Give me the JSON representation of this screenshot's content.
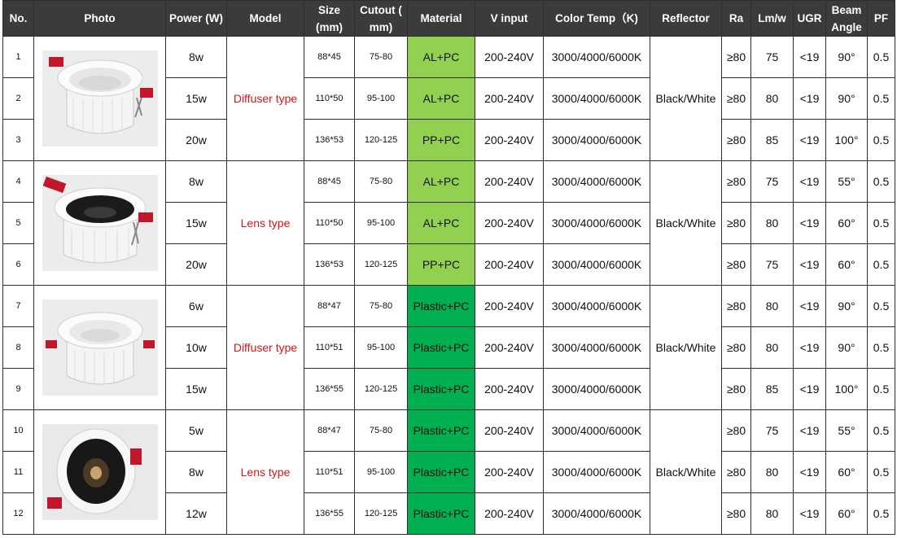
{
  "columns": {
    "no": "No.",
    "photo": "Photo",
    "power": "Power (W)",
    "model": "Model",
    "size": "Size (mm)",
    "cutout": "Cutout ( mm)",
    "material": "Material",
    "vinput": "V input",
    "colortemp": "Color Temp（K)",
    "reflector": "Reflector",
    "ra": "Ra",
    "lmw": "Lm/w",
    "ugr": "UGR",
    "beam": "Beam Angle",
    "pf": "PF"
  },
  "groups": [
    {
      "model": "Diffuser type",
      "reflector": "Black/White",
      "photo_icon": "white-diffuser-downlight-photo"
    },
    {
      "model": "Lens type",
      "reflector": "Black/White",
      "photo_icon": "black-lens-downlight-photo"
    },
    {
      "model": "Diffuser type",
      "reflector": "Black/White",
      "photo_icon": "white-plastic-diffuser-downlight-photo"
    },
    {
      "model": "Lens type",
      "reflector": "Black/White",
      "photo_icon": "black-plastic-lens-downlight-photo"
    }
  ],
  "rows": [
    {
      "no": "1",
      "power": "8w",
      "size": "88*45",
      "cutout": "75-80",
      "material": "AL+PC",
      "vinput": "200-240V",
      "colortemp": "3000/4000/6000K",
      "ra": "≥80",
      "lmw": "75",
      "ugr": "<19",
      "beam": "90°",
      "pf": "0.5"
    },
    {
      "no": "2",
      "power": "15w",
      "size": "110*50",
      "cutout": "95-100",
      "material": "AL+PC",
      "vinput": "200-240V",
      "colortemp": "3000/4000/6000K",
      "ra": "≥80",
      "lmw": "80",
      "ugr": "<19",
      "beam": "90°",
      "pf": "0.5"
    },
    {
      "no": "3",
      "power": "20w",
      "size": "136*53",
      "cutout": "120-125",
      "material": "PP+PC",
      "vinput": "200-240V",
      "colortemp": "3000/4000/6000K",
      "ra": "≥80",
      "lmw": "85",
      "ugr": "<19",
      "beam": "100°",
      "pf": "0.5"
    },
    {
      "no": "4",
      "power": "8w",
      "size": "88*45",
      "cutout": "75-80",
      "material": "AL+PC",
      "vinput": "200-240V",
      "colortemp": "3000/4000/6000K",
      "ra": "≥80",
      "lmw": "75",
      "ugr": "<19",
      "beam": "55°",
      "pf": "0.5"
    },
    {
      "no": "5",
      "power": "15w",
      "size": "110*50",
      "cutout": "95-100",
      "material": "AL+PC",
      "vinput": "200-240V",
      "colortemp": "3000/4000/6000K",
      "ra": "≥80",
      "lmw": "80",
      "ugr": "<19",
      "beam": "60°",
      "pf": "0.5"
    },
    {
      "no": "6",
      "power": "20w",
      "size": "136*53",
      "cutout": "120-125",
      "material": "PP+PC",
      "vinput": "200-240V",
      "colortemp": "3000/4000/6000K",
      "ra": "≥80",
      "lmw": "75",
      "ugr": "<19",
      "beam": "60°",
      "pf": "0.5"
    },
    {
      "no": "7",
      "power": "6w",
      "size": "88*47",
      "cutout": "75-80",
      "material": "Plastic+PC",
      "vinput": "200-240V",
      "colortemp": "3000/4000/6000K",
      "ra": "≥80",
      "lmw": "80",
      "ugr": "<19",
      "beam": "90°",
      "pf": "0.5"
    },
    {
      "no": "8",
      "power": "10w",
      "size": "110*51",
      "cutout": "95-100",
      "material": "Plastic+PC",
      "vinput": "200-240V",
      "colortemp": "3000/4000/6000K",
      "ra": "≥80",
      "lmw": "80",
      "ugr": "<19",
      "beam": "90°",
      "pf": "0.5"
    },
    {
      "no": "9",
      "power": "15w",
      "size": "136*55",
      "cutout": "120-125",
      "material": "Plastic+PC",
      "vinput": "200-240V",
      "colortemp": "3000/4000/6000K",
      "ra": "≥80",
      "lmw": "85",
      "ugr": "<19",
      "beam": "100°",
      "pf": "0.5"
    },
    {
      "no": "10",
      "power": "5w",
      "size": "88*47",
      "cutout": "75-80",
      "material": "Plastic+PC",
      "vinput": "200-240V",
      "colortemp": "3000/4000/6000K",
      "ra": "≥80",
      "lmw": "75",
      "ugr": "<19",
      "beam": "55°",
      "pf": "0.5"
    },
    {
      "no": "11",
      "power": "8w",
      "size": "110*51",
      "cutout": "95-100",
      "material": "Plastic+PC",
      "vinput": "200-240V",
      "colortemp": "3000/4000/6000K",
      "ra": "≥80",
      "lmw": "80",
      "ugr": "<19",
      "beam": "60°",
      "pf": "0.5"
    },
    {
      "no": "12",
      "power": "12w",
      "size": "136*55",
      "cutout": "120-125",
      "material": "Plastic+PC",
      "vinput": "200-240V",
      "colortemp": "3000/4000/6000K",
      "ra": "≥80",
      "lmw": "80",
      "ugr": "<19",
      "beam": "60°",
      "pf": "0.5"
    }
  ],
  "colors": {
    "header_bg": "#3b3b3b",
    "header_text": "#ffffff",
    "model_text": "#d01818",
    "material_al_pp": "#92d050",
    "material_plastic": "#00b050"
  }
}
